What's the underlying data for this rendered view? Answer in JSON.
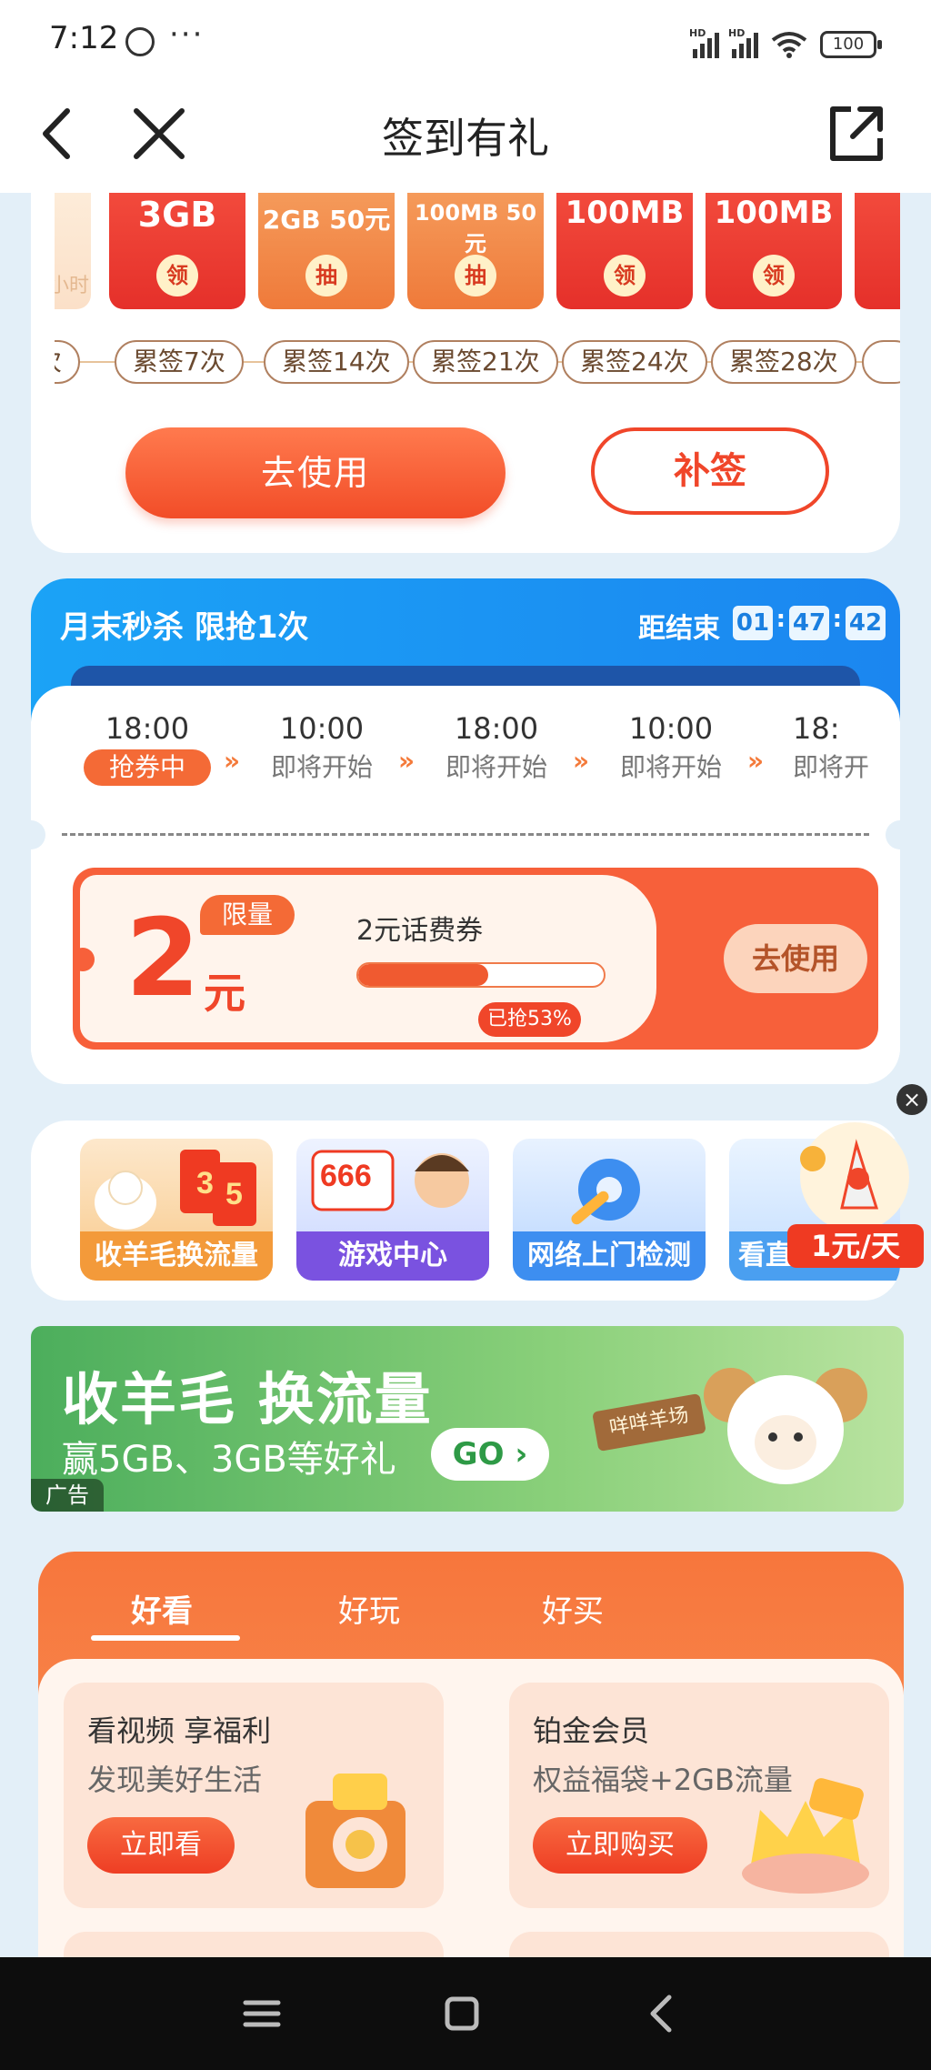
{
  "status_bar": {
    "time": "7:12",
    "more": "···",
    "network_1": "HD",
    "network_2": "HD",
    "battery": "100"
  },
  "nav": {
    "title": "签到有礼"
  },
  "checkin": {
    "prizes": [
      {
        "label": "",
        "badge": "",
        "faint": "小时",
        "type": "first"
      },
      {
        "label": "3GB",
        "badge": "领",
        "type": "claim"
      },
      {
        "label": "2GB 50元",
        "badge": "抽",
        "type": "lottery"
      },
      {
        "label": "100MB 50元",
        "badge": "抽",
        "type": "lottery"
      },
      {
        "label": "100MB",
        "badge": "领",
        "type": "claim"
      },
      {
        "label": "100MB",
        "badge": "领",
        "type": "claim"
      }
    ],
    "track": [
      "次",
      "累签7次",
      "累签14次",
      "累签21次",
      "累签24次",
      "累签28次"
    ],
    "use_button": "去使用",
    "resign_button": "补签"
  },
  "flash_sale": {
    "title": "月末秒杀  限抢1次",
    "ends_label": "距结束",
    "countdown": {
      "h": "01",
      "m": "47",
      "s": "42"
    },
    "slots": [
      {
        "time": "18:00",
        "status": "抢券中",
        "active": true
      },
      {
        "time": "10:00",
        "status": "即将开始"
      },
      {
        "time": "18:00",
        "status": "即将开始"
      },
      {
        "time": "10:00",
        "status": "即将开始"
      },
      {
        "time": "18:",
        "status": "即将开"
      }
    ],
    "coupon": {
      "amount": "2",
      "unit": "元",
      "tag": "限量",
      "name": "2元话费券",
      "progress": 0.53,
      "progress_label": "已抢53%",
      "button": "去使用"
    }
  },
  "entries": [
    {
      "name": "收羊毛换流量",
      "color": "#f2a24a"
    },
    {
      "name": "游戏中心",
      "color": "#7a52e0"
    },
    {
      "name": "网络上门检测",
      "color": "#3d8ef0"
    },
    {
      "name": "看直播",
      "color": "#4a9ff0"
    }
  ],
  "float_ad": {
    "price": "1元/天",
    "close": "×"
  },
  "banner": {
    "title": "收羊毛 换流量",
    "subtitle": "赢5GB、3GB等好礼",
    "go": "GO",
    "ad_label": "广告",
    "sign": "咩咩羊场"
  },
  "tabs": [
    {
      "label": "好看",
      "active": true
    },
    {
      "label": "好玩"
    },
    {
      "label": "好买"
    }
  ],
  "cards": [
    {
      "title": "看视频 享福利",
      "subtitle": "发现美好生活",
      "button": "立即看"
    },
    {
      "title": "铂金会员",
      "subtitle": "权益福袋+2GB流量",
      "button": "立即购买"
    }
  ],
  "colors": {
    "accent": "#f0462a",
    "flash_blue": "#1b86f0",
    "page_bg": "#e3eff8"
  }
}
